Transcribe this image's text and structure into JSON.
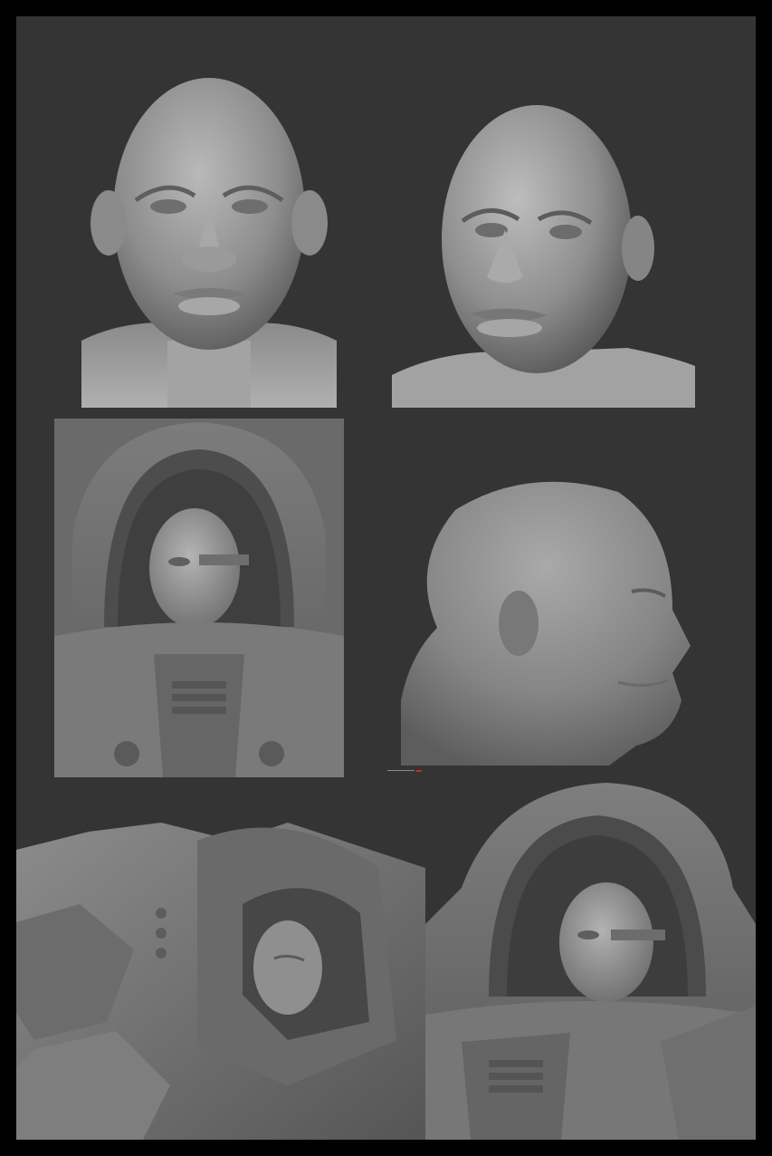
{
  "sheet": {
    "border_color": "#000000",
    "background_color": "#343434",
    "clay_color": "#8a8a8a"
  },
  "panels": [
    {
      "id": "head-front",
      "view": "front"
    },
    {
      "id": "head-three-quarter",
      "view": "three-quarter"
    },
    {
      "id": "armor-front",
      "view": "armor-front"
    },
    {
      "id": "head-profile",
      "view": "profile"
    },
    {
      "id": "armor-side",
      "view": "armor-side"
    },
    {
      "id": "armor-three-quarter",
      "view": "armor-three-quarter"
    }
  ]
}
